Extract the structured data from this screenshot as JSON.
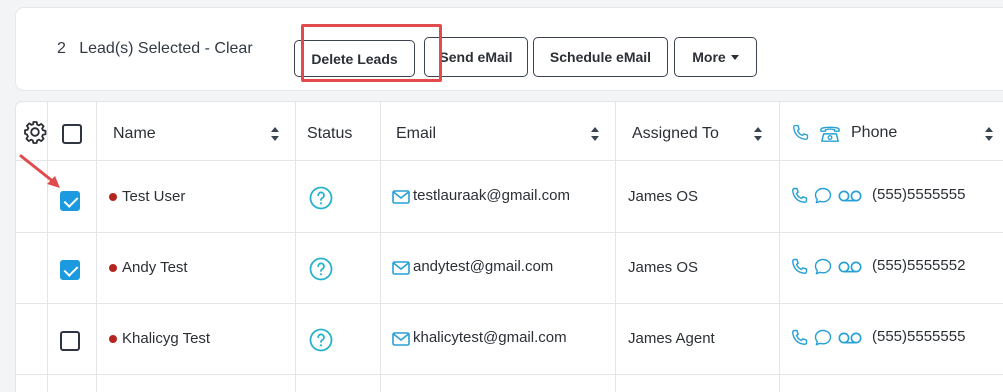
{
  "action_bar": {
    "selection_text": "2   Lead(s) Selected - Clear",
    "buttons": {
      "delete": "Delete Leads",
      "send_email": "Send eMail",
      "schedule_email": "Schedule eMail",
      "more": "More"
    }
  },
  "table": {
    "headers": {
      "name": "Name",
      "status": "Status",
      "email": "Email",
      "assigned_to": "Assigned To",
      "phone": "Phone"
    },
    "rows": [
      {
        "checked": true,
        "name": "Test User",
        "email": "testlauraak@gmail.com",
        "assigned_to": "James OS",
        "phone": "(555)5555555"
      },
      {
        "checked": true,
        "name": "Andy Test",
        "email": "andytest@gmail.com",
        "assigned_to": "James OS",
        "phone": "(555)5555552"
      },
      {
        "checked": false,
        "name": "Khalicyg Test",
        "email": "khalicytest@gmail.com",
        "assigned_to": "James Agent",
        "phone": "(555)5555555"
      }
    ]
  },
  "colors": {
    "accent_blue": "#1b9ae0",
    "status_teal": "#27b3cc",
    "highlight_red": "#e14b4b",
    "dot_red": "#b3261e"
  },
  "icons": [
    "gear-icon",
    "sort-icon",
    "phone-icon",
    "landline-icon",
    "status-question-icon",
    "mail-icon",
    "chat-icon",
    "voicemail-icon",
    "caret-down-icon"
  ]
}
